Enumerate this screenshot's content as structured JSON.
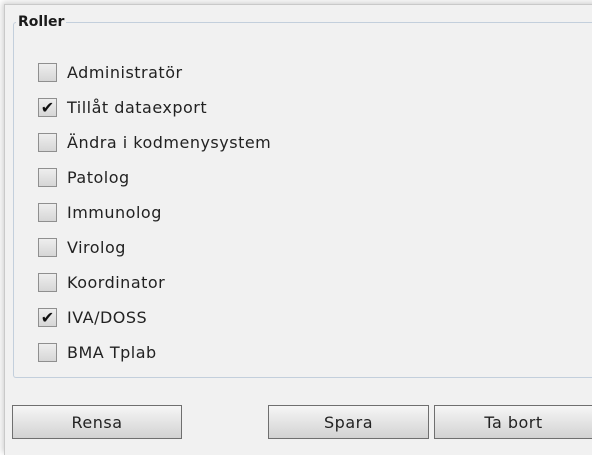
{
  "roles_panel": {
    "legend": "Roller",
    "roles": [
      {
        "label": "Administratör",
        "checked": false,
        "check_glyph": ""
      },
      {
        "label": "Tillåt dataexport",
        "checked": true,
        "check_glyph": "✔"
      },
      {
        "label": "Ändra i kodmenysystem",
        "checked": false,
        "check_glyph": ""
      },
      {
        "label": "Patolog",
        "checked": false,
        "check_glyph": ""
      },
      {
        "label": "Immunolog",
        "checked": false,
        "check_glyph": ""
      },
      {
        "label": "Virolog",
        "checked": false,
        "check_glyph": ""
      },
      {
        "label": "Koordinator",
        "checked": false,
        "check_glyph": ""
      },
      {
        "label": "IVA/DOSS",
        "checked": true,
        "check_glyph": "✔"
      },
      {
        "label": "BMA Tplab",
        "checked": false,
        "check_glyph": ""
      }
    ]
  },
  "buttons": {
    "clear_label": "Rensa",
    "save_label": "Spara",
    "delete_label": "Ta bort"
  }
}
